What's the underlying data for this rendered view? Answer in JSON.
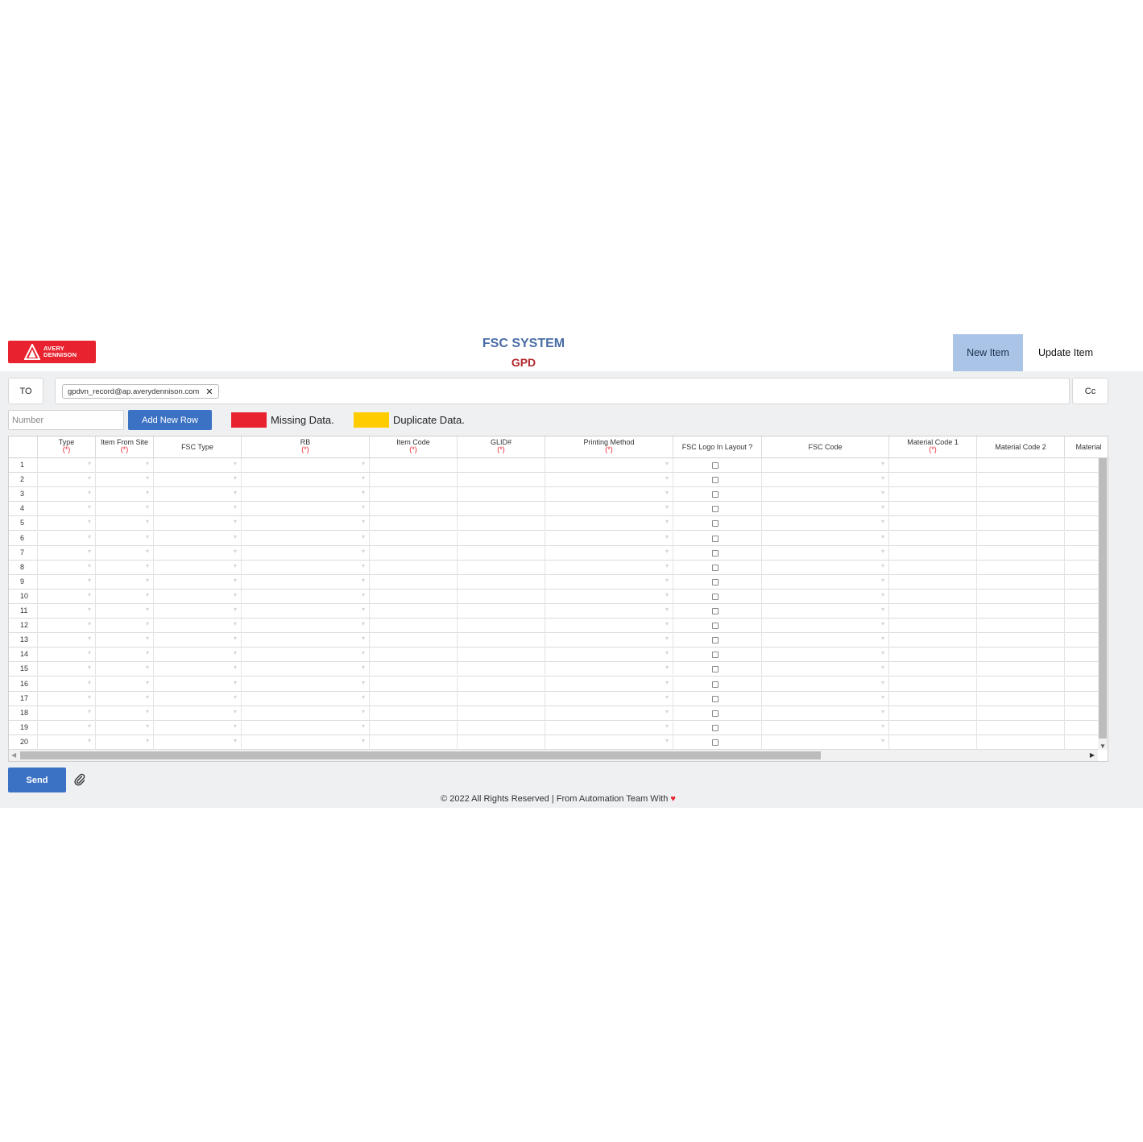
{
  "header": {
    "logo_text_line1": "AVERY",
    "logo_text_line2": "DENNISON",
    "title": "FSC SYSTEM",
    "subtitle": "GPD",
    "nav": {
      "new_item": "New Item",
      "update_item": "Update Item"
    },
    "active_nav": "new_item",
    "accent_color": "#a9c4e7",
    "brand_color": "#e8232f"
  },
  "email": {
    "to_label": "TO",
    "cc_label": "Cc",
    "recipients": [
      "gpdvn_record@ap.averydennison.com"
    ],
    "remove_icon": "close-icon"
  },
  "toolbar": {
    "number_placeholder": "Number",
    "add_row_label": "Add New Row",
    "legend": [
      {
        "label": "Missing Data.",
        "color": "#e8232f"
      },
      {
        "label": "Duplicate Data.",
        "color": "#ffcc00"
      }
    ]
  },
  "grid": {
    "required_marker": "(*)",
    "columns": [
      {
        "label": "Type",
        "required": true,
        "kind": "dropdown"
      },
      {
        "label": "Item From Site",
        "required": true,
        "kind": "dropdown"
      },
      {
        "label": "FSC Type",
        "required": false,
        "kind": "dropdown"
      },
      {
        "label": "RB",
        "required": true,
        "kind": "dropdown"
      },
      {
        "label": "Item Code",
        "required": true,
        "kind": "text"
      },
      {
        "label": "GLID#",
        "required": true,
        "kind": "text"
      },
      {
        "label": "Printing Method",
        "required": true,
        "kind": "dropdown"
      },
      {
        "label": "FSC Logo In Layout ?",
        "required": false,
        "kind": "checkbox"
      },
      {
        "label": "FSC Code",
        "required": false,
        "kind": "dropdown"
      },
      {
        "label": "Material Code 1",
        "required": true,
        "kind": "text"
      },
      {
        "label": "Material Code 2",
        "required": false,
        "kind": "text"
      },
      {
        "label": "Material",
        "required": false,
        "kind": "text"
      }
    ],
    "row_numbers": [
      1,
      2,
      3,
      4,
      5,
      6,
      7,
      8,
      9,
      10,
      11,
      12,
      13,
      14,
      15,
      16,
      17,
      18,
      19,
      20
    ]
  },
  "actions": {
    "send_label": "Send",
    "attach_icon": "paperclip-icon"
  },
  "footer": {
    "text": "© 2022 All Rights Reserved | From Automation Team With",
    "heart": "♥"
  }
}
